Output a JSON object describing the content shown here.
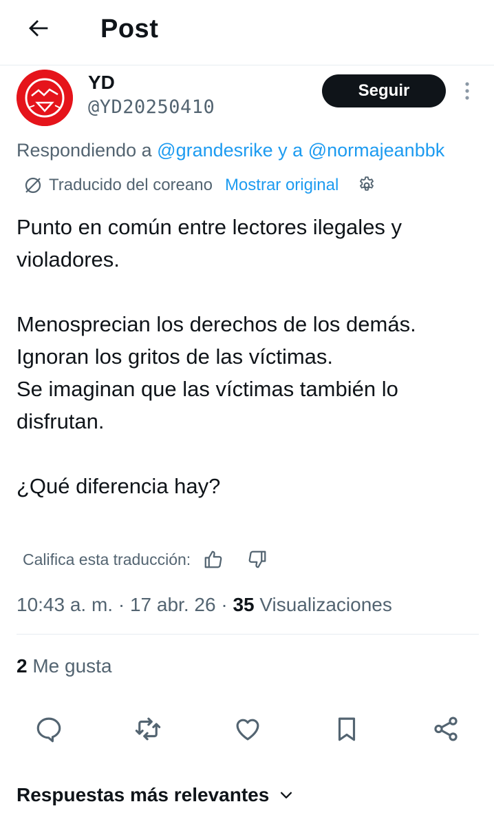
{
  "header": {
    "title": "Post",
    "back_icon": "arrow-left-icon"
  },
  "post": {
    "author": {
      "name": "YD",
      "handle": "@YD20250410",
      "avatar_color": "#e5141b"
    },
    "follow_label": "Seguir",
    "reply_context": {
      "prefix": "Respondiendo a ",
      "mention1": "@grandesrike",
      "conjunction": " y a ",
      "mention2": "@normajeanbbk"
    },
    "translation": {
      "label": "Traducido del coreano",
      "show_original": "Mostrar original"
    },
    "body": {
      "line1": "Punto en común entre lectores ilegales y violadores.",
      "line2": "Menosprecian los derechos de los demás.",
      "line3": "Ignoran los gritos de las víctimas.",
      "line4": "Se imaginan que las víctimas también lo disfrutan.",
      "line5": "¿Qué diferencia hay?"
    },
    "rate_translation_label": "Califica esta traducción:",
    "meta": {
      "time": "10:43 a. m.",
      "sep1": " · ",
      "date": "17 abr. 26",
      "sep2": " · ",
      "views_count": "35",
      "views_label": " Visualizaciones"
    },
    "likes": {
      "count": "2",
      "label": " Me gusta"
    },
    "actions": [
      "reply-icon",
      "repost-icon",
      "like-icon",
      "bookmark-icon",
      "share-icon"
    ]
  },
  "replies_sort": {
    "label": "Respuestas más relevantes"
  },
  "colors": {
    "link": "#1d9bf0",
    "secondary_text": "#536471",
    "primary_text": "#0f1419",
    "divider": "#e6ecf0"
  }
}
